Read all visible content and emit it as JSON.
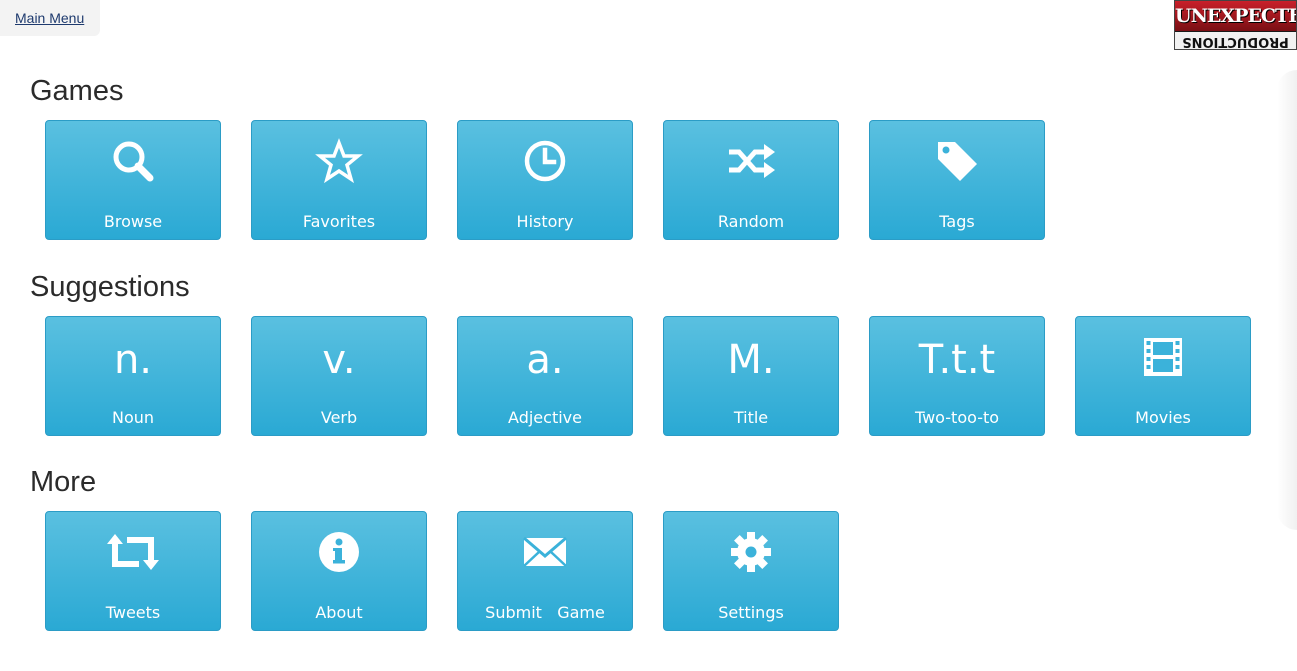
{
  "nav": {
    "main_menu_label": "Main Menu"
  },
  "logo": {
    "top_text": "UNEXPECTED",
    "bottom_text": "PRODUCTIONS"
  },
  "colors": {
    "tile_gradient_top": "#5ac0e0",
    "tile_gradient_bottom": "#2aa9d4",
    "tile_text": "#ffffff"
  },
  "sections": {
    "games": {
      "title": "Games",
      "tiles": [
        {
          "label": "Browse",
          "icon": "search-icon"
        },
        {
          "label": "Favorites",
          "icon": "star-icon"
        },
        {
          "label": "History",
          "icon": "clock-icon"
        },
        {
          "label": "Random",
          "icon": "shuffle-icon"
        },
        {
          "label": "Tags",
          "icon": "tag-icon"
        }
      ]
    },
    "suggestions": {
      "title": "Suggestions",
      "tiles": [
        {
          "label": "Noun",
          "glyph": "n."
        },
        {
          "label": "Verb",
          "glyph": "v."
        },
        {
          "label": "Adjective",
          "glyph": "a."
        },
        {
          "label": "Title",
          "glyph": "M."
        },
        {
          "label": "Two-too-to",
          "glyph": "T.t.t"
        },
        {
          "label": "Movies",
          "icon": "film-icon"
        }
      ]
    },
    "more": {
      "title": "More",
      "tiles": [
        {
          "label": "Tweets",
          "icon": "retweet-icon"
        },
        {
          "label": "About",
          "icon": "info-icon"
        },
        {
          "label": "Submit   Game",
          "icon": "envelope-icon"
        },
        {
          "label": "Settings",
          "icon": "gear-icon"
        }
      ]
    }
  }
}
